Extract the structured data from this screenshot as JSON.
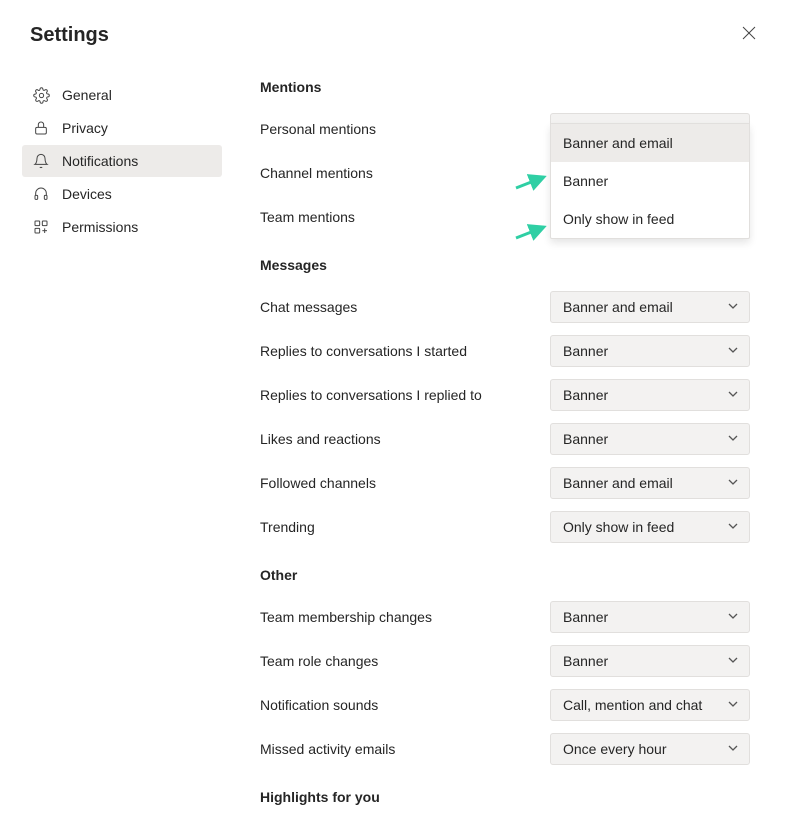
{
  "header": {
    "title": "Settings"
  },
  "sidebar": {
    "items": [
      {
        "id": "general",
        "label": "General",
        "icon": "gear-icon"
      },
      {
        "id": "privacy",
        "label": "Privacy",
        "icon": "lock-icon"
      },
      {
        "id": "notifications",
        "label": "Notifications",
        "icon": "bell-icon"
      },
      {
        "id": "devices",
        "label": "Devices",
        "icon": "headset-icon"
      },
      {
        "id": "permissions",
        "label": "Permissions",
        "icon": "app-icon"
      }
    ],
    "active": "notifications"
  },
  "sections": {
    "mentions": {
      "title": "Mentions",
      "rows": [
        {
          "label": "Personal mentions",
          "value": "Banner and email"
        },
        {
          "label": "Channel mentions",
          "value": ""
        },
        {
          "label": "Team mentions",
          "value": ""
        }
      ]
    },
    "messages": {
      "title": "Messages",
      "rows": [
        {
          "label": "Chat messages",
          "value": "Banner and email"
        },
        {
          "label": "Replies to conversations I started",
          "value": "Banner"
        },
        {
          "label": "Replies to conversations I replied to",
          "value": "Banner"
        },
        {
          "label": "Likes and reactions",
          "value": "Banner"
        },
        {
          "label": "Followed channels",
          "value": "Banner and email"
        },
        {
          "label": "Trending",
          "value": "Only show in feed"
        }
      ]
    },
    "other": {
      "title": "Other",
      "rows": [
        {
          "label": "Team membership changes",
          "value": "Banner"
        },
        {
          "label": "Team role changes",
          "value": "Banner"
        },
        {
          "label": "Notification sounds",
          "value": "Call, mention and chat"
        },
        {
          "label": "Missed activity emails",
          "value": "Once every hour"
        }
      ]
    },
    "highlights": {
      "title": "Highlights for you"
    }
  },
  "dropdownMenu": {
    "options": [
      "Banner and email",
      "Banner",
      "Only show in feed"
    ],
    "highlighted": "Banner and email"
  }
}
